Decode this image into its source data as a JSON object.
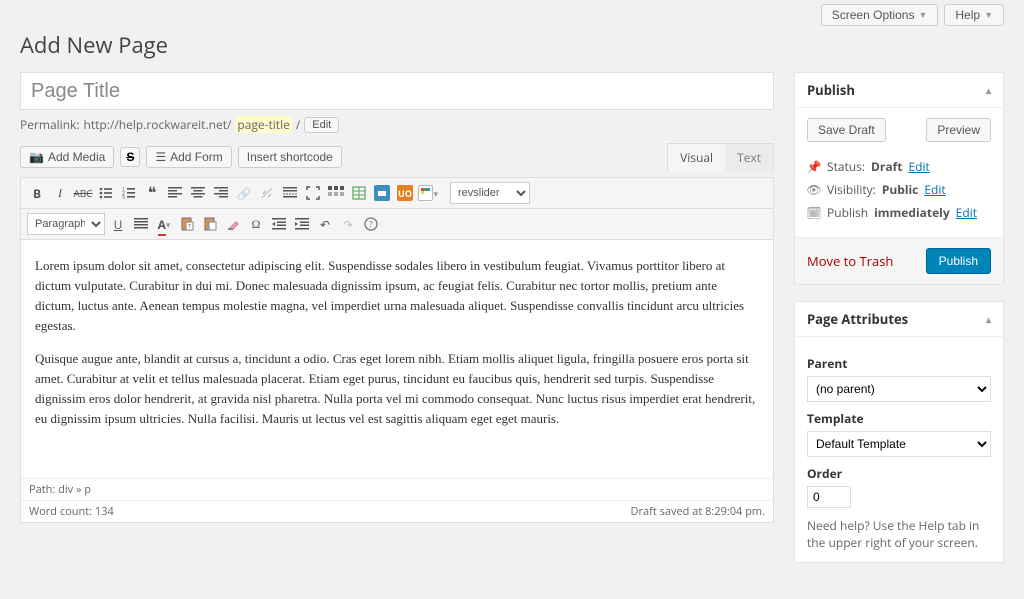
{
  "topbar": {
    "screen_options": "Screen Options",
    "help": "Help"
  },
  "heading": "Add New Page",
  "title_input": "Page Title",
  "permalink": {
    "label": "Permalink:",
    "base": "http://help.rockwareit.net/",
    "slug": "page-title",
    "slash": "/",
    "edit": "Edit"
  },
  "media_row": {
    "add_media": "Add Media",
    "s_btn": "S",
    "add_form": "Add Form",
    "insert_shortcode": "Insert shortcode"
  },
  "tabs": {
    "visual": "Visual",
    "text": "Text"
  },
  "toolbar": {
    "paragraph": "Paragraph",
    "revslider": "revslider",
    "uo": "UO"
  },
  "content": {
    "p1": "Lorem ipsum dolor sit amet, consectetur adipiscing elit. Suspendisse sodales libero in vestibulum feugiat. Vivamus porttitor libero at dictum vulputate. Curabitur in dui mi. Donec malesuada dignissim ipsum, ac feugiat felis. Curabitur nec tortor mollis, pretium ante dictum, luctus ante. Aenean tempus molestie magna, vel imperdiet urna malesuada aliquet. Suspendisse convallis tincidunt arcu ultricies egestas.",
    "p2": "Quisque augue ante, blandit at cursus a, tincidunt a odio. Cras eget lorem nibh. Etiam mollis aliquet ligula, fringilla posuere eros porta sit amet. Curabitur at velit et tellus malesuada placerat. Etiam eget purus, tincidunt eu faucibus quis, hendrerit sed turpis. Suspendisse dignissim eros dolor hendrerit, at gravida nisl pharetra. Nulla porta vel mi commodo consequat. Nunc luctus risus imperdiet erat hendrerit, eu dignissim ipsum ultricies. Nulla facilisi. Mauris ut lectus vel est sagittis aliquam eget eget mauris."
  },
  "path_bar": "Path: div » p",
  "status_bar": {
    "word_count": "Word count: 134",
    "saved": "Draft saved at 8:29:04 pm."
  },
  "publish": {
    "title": "Publish",
    "save_draft": "Save Draft",
    "preview": "Preview",
    "status_label": "Status:",
    "status_value": "Draft",
    "status_edit": "Edit",
    "visibility_label": "Visibility:",
    "visibility_value": "Public",
    "visibility_edit": "Edit",
    "schedule_label": "Publish",
    "schedule_value": "immediately",
    "schedule_edit": "Edit",
    "trash": "Move to Trash",
    "publish_btn": "Publish"
  },
  "attributes": {
    "title": "Page Attributes",
    "parent_label": "Parent",
    "parent_value": "(no parent)",
    "template_label": "Template",
    "template_value": "Default Template",
    "order_label": "Order",
    "order_value": "0",
    "help_text": "Need help? Use the Help tab in the upper right of your screen."
  }
}
